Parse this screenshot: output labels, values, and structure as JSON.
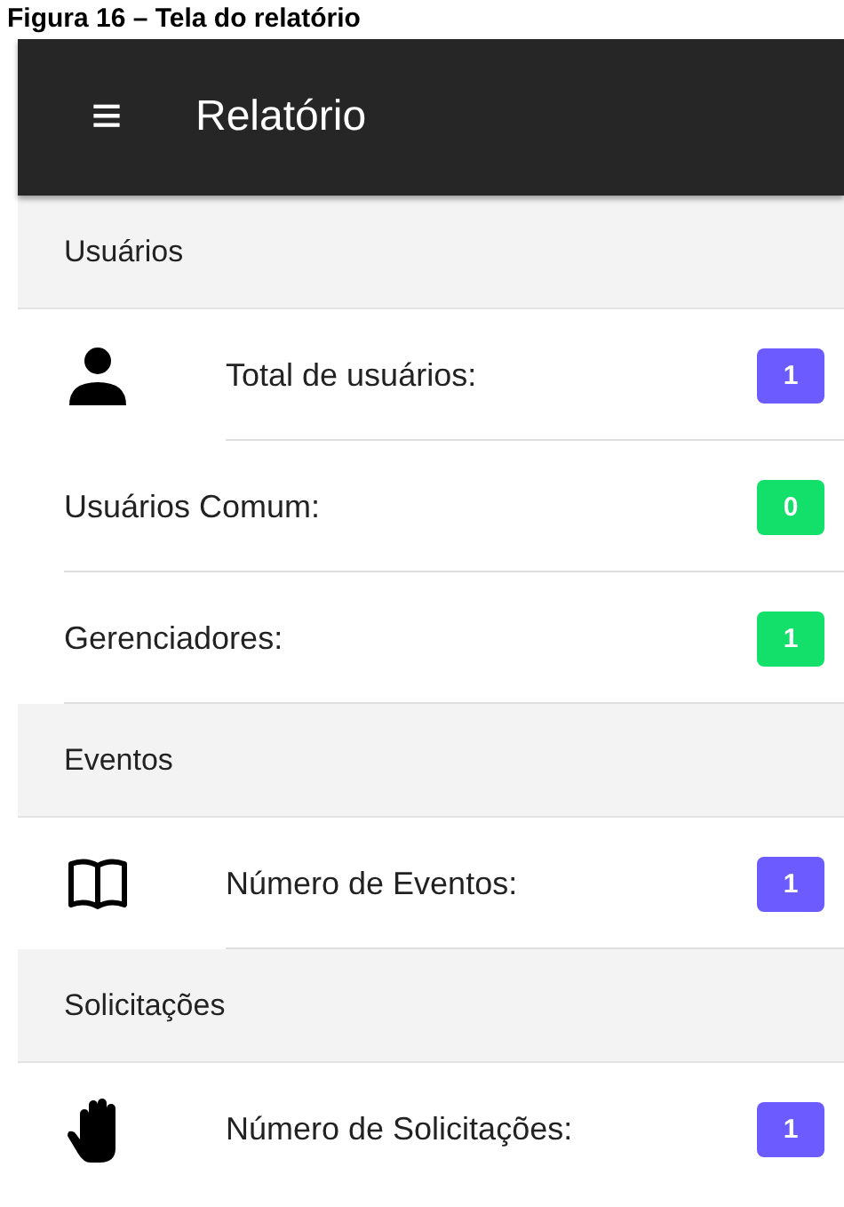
{
  "caption": "Figura 16 – Tela do relatório",
  "app_bar": {
    "menu_icon": "≡",
    "title": "Relatório"
  },
  "sections": [
    {
      "title": "Usuários",
      "items": [
        {
          "kind": "user",
          "label": "Total de usuários:",
          "count": "1",
          "color": "#6c5cff"
        },
        {
          "kind": "plain",
          "label": "Usuários Comum:",
          "count": "0",
          "color": "#12e06a"
        },
        {
          "kind": "plain",
          "label": "Gerenciadores:",
          "count": "1",
          "color": "#12e06a"
        }
      ]
    },
    {
      "title": "Eventos",
      "items": [
        {
          "kind": "book",
          "label": "Número de Eventos:",
          "count": "1",
          "color": "#6c5cff"
        }
      ]
    },
    {
      "title": "Solicitações",
      "items": [
        {
          "kind": "hand",
          "label": "Número de Solicitações:",
          "count": "1",
          "color": "#6c5cff"
        }
      ]
    }
  ]
}
